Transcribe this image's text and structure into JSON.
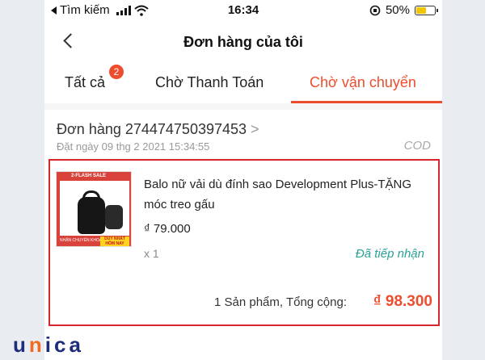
{
  "status_bar": {
    "back_app": "Tìm kiếm",
    "time": "16:34",
    "battery": "50%",
    "battery_level": 0.5
  },
  "header": {
    "title": "Đơn hàng của tôi"
  },
  "tabs": [
    {
      "label": "Tất cả",
      "badge": "2"
    },
    {
      "label": "Chờ Thanh Toán"
    },
    {
      "label": "Chờ vận chuyển",
      "active": true
    }
  ],
  "order": {
    "id_text": "Đơn hàng 274474750397453",
    "chevron": ">",
    "date": "Đặt ngày 09 thg 2 2021  15:34:55",
    "payment": "COD",
    "product": {
      "name": "Balo nữ vải dù đính sao Development Plus-TẶNG móc treo gấu",
      "price": "₫ 79.000",
      "qty": "x 1",
      "image_top_text": "2-FLASH SALE",
      "image_sale_text": "DUY NHẤT HÔM NAY",
      "image_bottom_text": "NHẬN CHUYỂN KHOẢNG"
    },
    "status": "Đã tiếp nhận",
    "total_label": "1 Sản phẩm, Tổng cộng:",
    "total_value": "₫ 98.300"
  },
  "watermark": {
    "part1": "u",
    "accent": "n",
    "part2": "ica"
  },
  "colors": {
    "accent": "#ee4d2d",
    "highlight_box": "#d8262e",
    "status": "#2aa198"
  }
}
